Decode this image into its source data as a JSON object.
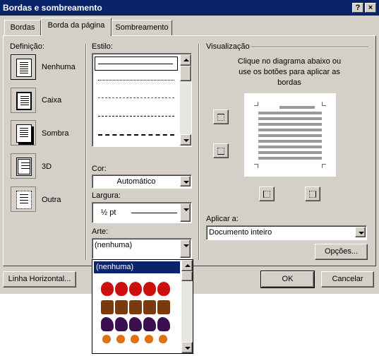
{
  "window": {
    "title": "Bordas e sombreamento",
    "help_label": "?",
    "close_label": "×"
  },
  "tabs": [
    {
      "label": "Bordas"
    },
    {
      "label": "Borda da página"
    },
    {
      "label": "Sombreamento"
    }
  ],
  "definicao": {
    "heading": "Definição:",
    "items": [
      {
        "label": "Nenhuma",
        "icon": "page-none-icon"
      },
      {
        "label": "Caixa",
        "icon": "page-box-icon"
      },
      {
        "label": "Sombra",
        "icon": "page-shadow-icon"
      },
      {
        "label": "3D",
        "icon": "page-3d-icon"
      },
      {
        "label": "Outra",
        "icon": "page-custom-icon"
      }
    ]
  },
  "estilo": {
    "heading": "Estilo:",
    "styles": [
      "solid",
      "dotted",
      "dashed-fine",
      "dashed",
      "dash-dot"
    ]
  },
  "cor": {
    "label": "Cor:",
    "value": "Automático"
  },
  "largura": {
    "label": "Largura:",
    "value": "½ pt"
  },
  "arte": {
    "label": "Arte:",
    "value": "(nenhuma)",
    "options": [
      "(nenhuma)"
    ],
    "selected_option": "(nenhuma)"
  },
  "visualizacao": {
    "heading": "Visualização",
    "instructions": "Clique no diagrama abaixo ou use os botões para aplicar as bordas"
  },
  "aplicar": {
    "label": "Aplicar a:",
    "value": "Documento inteiro"
  },
  "buttons": {
    "opcoes": "Opções...",
    "linha_horizontal": "Linha Horizontal...",
    "ok": "OK",
    "cancelar": "Cancelar"
  },
  "colors": {
    "title_bar": "#0a246a",
    "dialog_bg": "#d4d0c8",
    "selection": "#0a246a"
  }
}
